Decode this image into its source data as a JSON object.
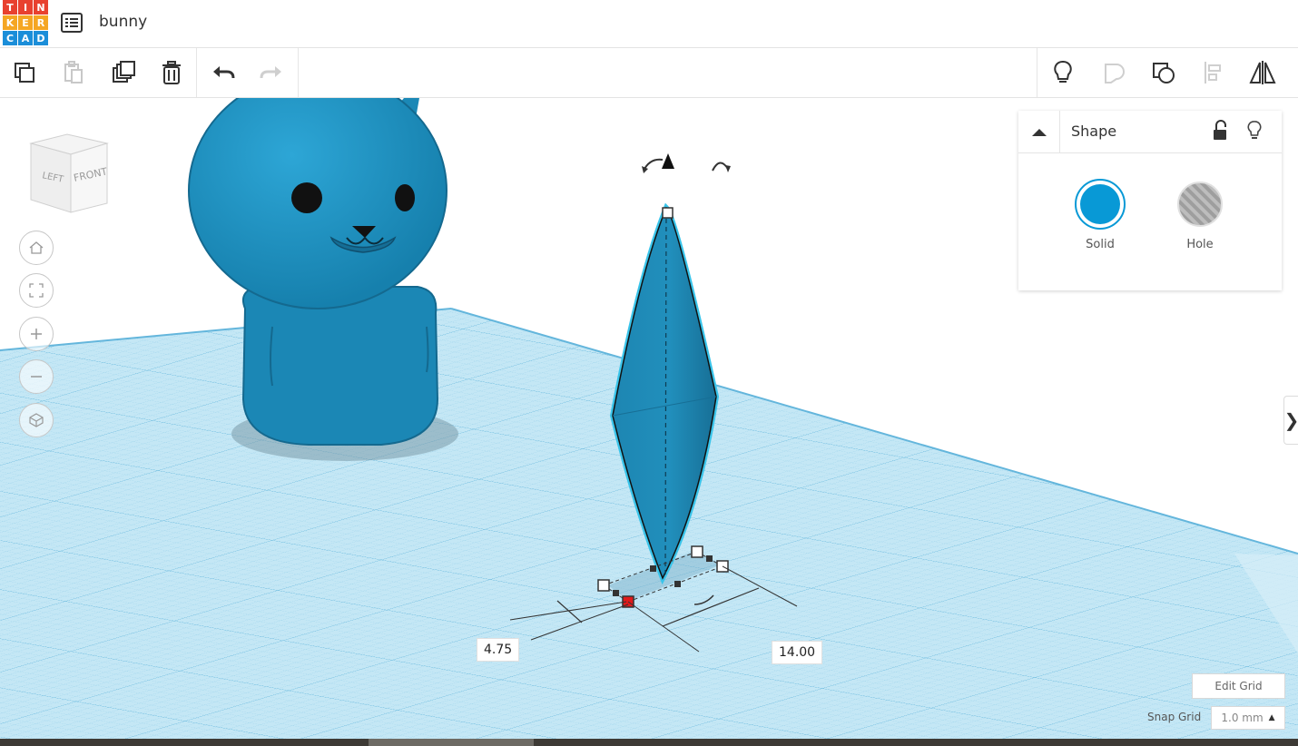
{
  "app": {
    "logo_letters": [
      "T",
      "I",
      "N",
      "K",
      "E",
      "R",
      "C",
      "A",
      "D"
    ],
    "logo_colors": [
      "#e8412f",
      "#e8412f",
      "#e8412f",
      "#f5a623",
      "#f5a623",
      "#f5a623",
      "#1b8ed9",
      "#1b8ed9",
      "#1b8ed9"
    ],
    "project_title": "bunny"
  },
  "toolbar": {
    "left_tools": [
      "copy-icon",
      "paste-icon",
      "duplicate-icon",
      "trash-icon",
      "undo-icon",
      "redo-icon"
    ],
    "right_tools": [
      "lightbulb-icon",
      "group-icon",
      "ungroup-icon",
      "align-icon",
      "mirror-icon"
    ]
  },
  "viewcube": {
    "left_label": "LEFT",
    "front_label": "FRONT"
  },
  "nav_controls": [
    "home-icon",
    "fit-view-icon",
    "zoom-in-icon",
    "zoom-out-icon",
    "ortho-view-icon"
  ],
  "inspector": {
    "title": "Shape",
    "solid_label": "Solid",
    "hole_label": "Hole",
    "accent": "#0899d6"
  },
  "dimensions": {
    "width": "4.75",
    "length": "14.00"
  },
  "grid": {
    "edit_label": "Edit Grid",
    "snap_label": "Snap Grid",
    "snap_value": "1.0 mm"
  },
  "colors": {
    "shape": "#1f8bb5",
    "shape_dark": "#17749a",
    "workplane": "#9fd7ee",
    "grid_line": "#7cc4e3",
    "selection": "#39c4ea"
  }
}
